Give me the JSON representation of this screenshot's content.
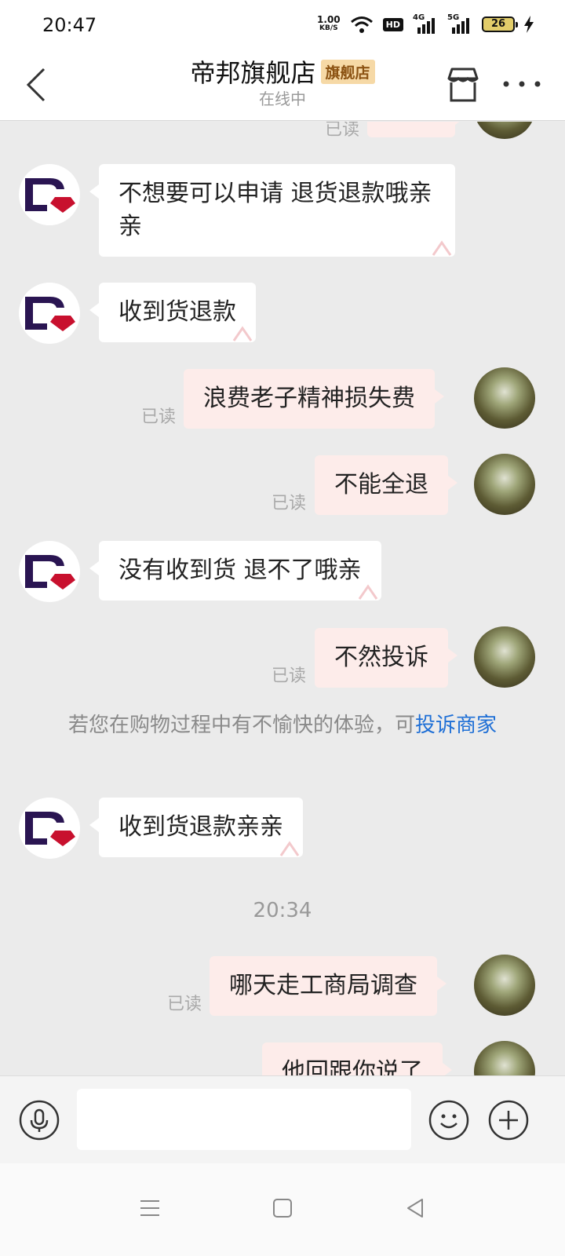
{
  "status_bar": {
    "time": "20:47",
    "net_speed_value": "1.00",
    "net_speed_unit": "KB/S",
    "hd_label": "HD",
    "signal1_label": "4G",
    "signal2_label": "5G",
    "battery": "26"
  },
  "header": {
    "shop_name": "帝邦旗舰店",
    "badge": "旗舰店",
    "status": "在线中",
    "icons": [
      "back-arrow-icon",
      "store-icon",
      "more-icon"
    ]
  },
  "messages": [
    {
      "side": "out",
      "text": "",
      "read": "已读",
      "partial": true
    },
    {
      "side": "in",
      "text": "不想要可以申请 退货退款哦亲亲"
    },
    {
      "side": "in",
      "text": "收到货退款"
    },
    {
      "side": "out",
      "text": "浪费老子精神损失费",
      "read": "已读"
    },
    {
      "side": "out",
      "text": "不能全退",
      "read": "已读"
    },
    {
      "side": "in",
      "text": "没有收到货 退不了哦亲"
    },
    {
      "side": "out",
      "text": "不然投诉",
      "read": "已读"
    },
    {
      "side": "in",
      "text": "收到货退款亲亲"
    },
    {
      "side": "out",
      "text": "哪天走工商局调查",
      "read": "已读"
    },
    {
      "side": "out",
      "text": "他回跟你说了",
      "partial": true
    }
  ],
  "system_tip": {
    "text": "若您在购物过程中有不愉快的体验，可",
    "link": "投诉商家"
  },
  "timestamp": "20:34",
  "input_bar": {
    "placeholder": "",
    "icons": [
      "microphone-icon",
      "emoji-icon",
      "plus-icon"
    ]
  },
  "system_nav": [
    "menu-icon",
    "home-square-icon",
    "back-triangle-icon"
  ]
}
